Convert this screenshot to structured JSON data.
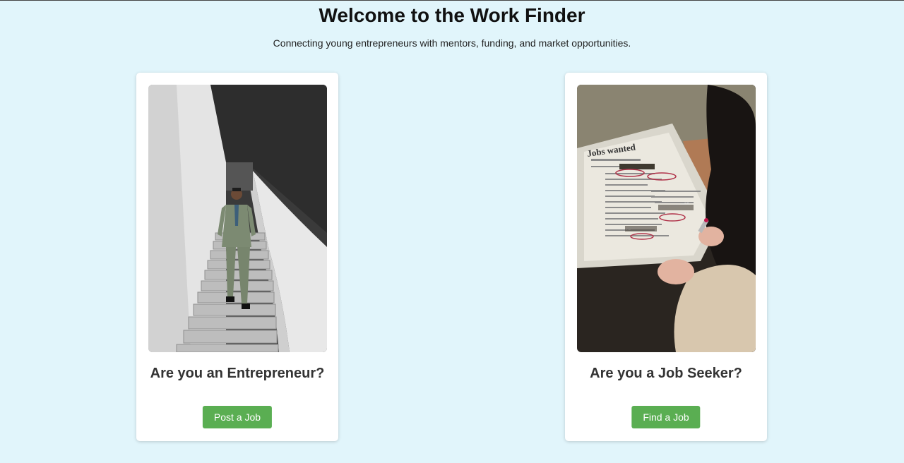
{
  "header": {
    "title": "Welcome to the Work Finder",
    "subtitle": "Connecting young entrepreneurs with mentors, funding, and market opportunities."
  },
  "cards": [
    {
      "heading": "Are you an Entrepreneur?",
      "button_label": "Post a Job",
      "image": "man-in-suit-on-stairs-photo"
    },
    {
      "heading": "Are you a Job Seeker?",
      "button_label": "Find a Job",
      "image": "newspaper-job-ads-photo",
      "image_text": {
        "masthead": "Jobs wanted",
        "headers": [
          "PART-TIME JOBS",
          "ADVERTISING"
        ]
      }
    }
  ],
  "colors": {
    "background": "#e1f5fb",
    "button": "#5aae52",
    "card": "#ffffff"
  }
}
